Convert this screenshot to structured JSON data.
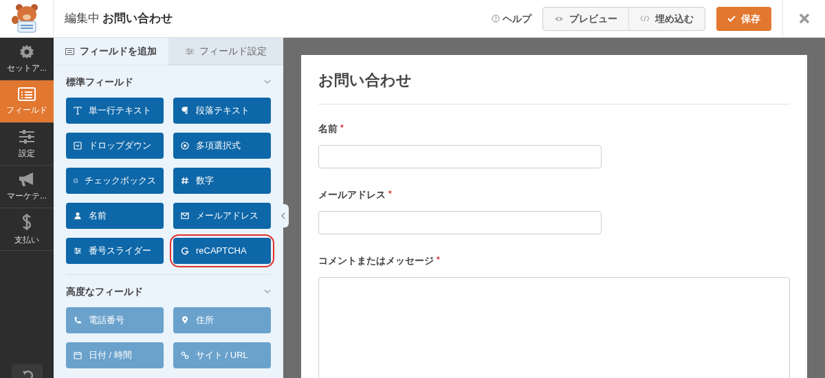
{
  "header": {
    "editing_label": "編集中",
    "form_name": "お問い合わせ",
    "help": "ヘルプ",
    "preview": "プレビュー",
    "embed": "埋め込む",
    "save": "保存"
  },
  "nav": [
    {
      "label": "セットア...",
      "selected": false
    },
    {
      "label": "フィールド",
      "selected": true
    },
    {
      "label": "設定",
      "selected": false
    },
    {
      "label": "マーケテ...",
      "selected": false
    },
    {
      "label": "支払い",
      "selected": false
    }
  ],
  "panel_tabs": [
    {
      "label": "フィールドを追加",
      "selected": true
    },
    {
      "label": "フィールド設定",
      "selected": false
    }
  ],
  "sections": [
    {
      "title": "標準フィールド",
      "fields": [
        {
          "label": "単一行テキスト",
          "disabled": false,
          "highlighted": false
        },
        {
          "label": "段落テキスト",
          "disabled": false,
          "highlighted": false
        },
        {
          "label": "ドロップダウン",
          "disabled": false,
          "highlighted": false
        },
        {
          "label": "多項選択式",
          "disabled": false,
          "highlighted": false
        },
        {
          "label": "チェックボックス",
          "disabled": false,
          "highlighted": false
        },
        {
          "label": "数字",
          "disabled": false,
          "highlighted": false
        },
        {
          "label": "名前",
          "disabled": false,
          "highlighted": false
        },
        {
          "label": "メールアドレス",
          "disabled": false,
          "highlighted": false
        },
        {
          "label": "番号スライダー",
          "disabled": false,
          "highlighted": false
        },
        {
          "label": "reCAPTCHA",
          "disabled": false,
          "highlighted": true
        }
      ]
    },
    {
      "title": "高度なフィールド",
      "fields": [
        {
          "label": "電話番号",
          "disabled": true,
          "highlighted": false
        },
        {
          "label": "住所",
          "disabled": true,
          "highlighted": false
        },
        {
          "label": "日付 / 時間",
          "disabled": true,
          "highlighted": false
        },
        {
          "label": "サイト / URL",
          "disabled": true,
          "highlighted": false
        }
      ]
    }
  ],
  "form": {
    "title": "お問い合わせ",
    "fields": [
      {
        "label": "名前",
        "required_mark": "*",
        "kind": "text"
      },
      {
        "label": "メールアドレス",
        "required_mark": "*",
        "kind": "text"
      },
      {
        "label": "コメントまたはメッセージ",
        "required_mark": "*",
        "kind": "textarea"
      }
    ]
  }
}
